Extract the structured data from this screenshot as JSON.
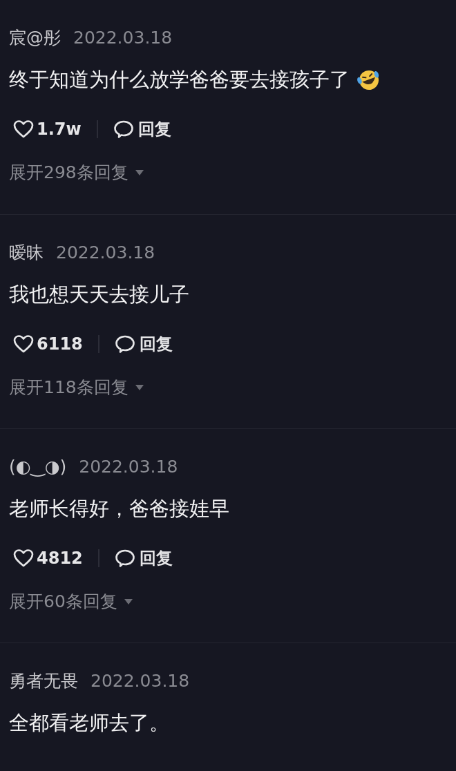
{
  "comments": [
    {
      "author": "宸@彤",
      "date": "2022.03.18",
      "text": "终于知道为什么放学爸爸要去接孩子了",
      "emoji": true,
      "likes": "1.7w",
      "reply": "回复",
      "expand": "展开298条回复"
    },
    {
      "author": "暧昧",
      "date": "2022.03.18",
      "text": "我也想天天去接儿子",
      "emoji": false,
      "likes": "6118",
      "reply": "回复",
      "expand": "展开118条回复"
    },
    {
      "author": "(◐‿◑)",
      "date": "2022.03.18",
      "text": "老师长得好，爸爸接娃早",
      "emoji": false,
      "likes": "4812",
      "reply": "回复",
      "expand": "展开60条回复"
    },
    {
      "author": "勇者无畏",
      "date": "2022.03.18",
      "text": "全都看老师去了。",
      "emoji": false
    }
  ]
}
